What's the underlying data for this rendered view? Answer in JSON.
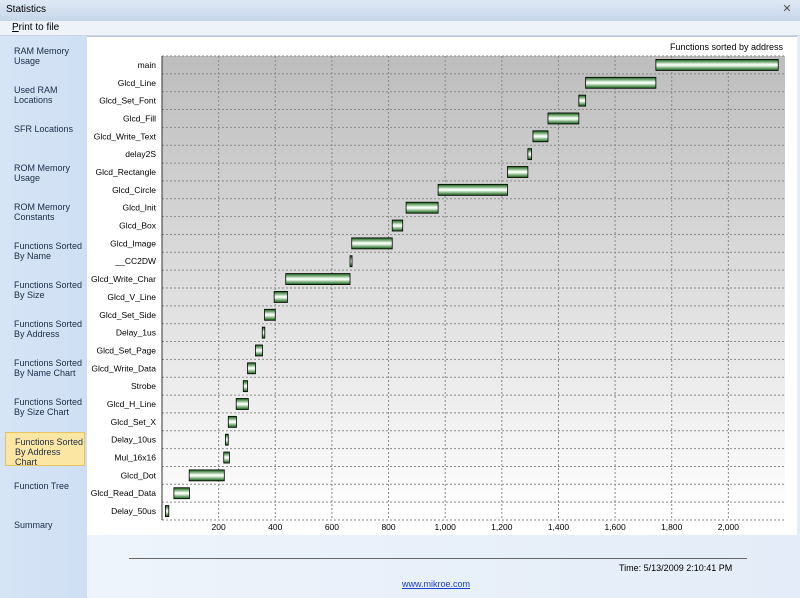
{
  "window": {
    "title": "Statistics",
    "close_glyph": "✕"
  },
  "menu": {
    "print_label_first": "P",
    "print_label_rest": "rint to file"
  },
  "sidebar": {
    "items": [
      {
        "line1": "RAM Memory",
        "line2": "Usage"
      },
      {
        "line1": "Used RAM",
        "line2": "Locations"
      },
      {
        "line1": "SFR Locations",
        "line2": ""
      },
      {
        "line1": "ROM Memory",
        "line2": "Usage"
      },
      {
        "line1": "ROM Memory",
        "line2": "Constants"
      },
      {
        "line1": "Functions Sorted",
        "line2": "By  Name"
      },
      {
        "line1": "Functions Sorted",
        "line2": "By Size"
      },
      {
        "line1": "Functions Sorted",
        "line2": "By Address"
      },
      {
        "line1": "Functions Sorted",
        "line2": "By Name Chart"
      },
      {
        "line1": "Functions Sorted",
        "line2": "By Size Chart"
      },
      {
        "line1": "Functions Sorted",
        "line2": "By Address Chart"
      },
      {
        "line1": "Function Tree",
        "line2": ""
      },
      {
        "line1": "Summary",
        "line2": ""
      }
    ],
    "active_index": 10
  },
  "chart_data": {
    "type": "bar",
    "orientation": "horizontal-range",
    "title": "Functions sorted by address",
    "xlabel": "",
    "ylabel": "",
    "xlim": [
      0,
      2200
    ],
    "xticks": [
      200,
      400,
      600,
      800,
      1000,
      1200,
      1400,
      1600,
      1800,
      2000
    ],
    "xtick_labels": [
      "200",
      "400",
      "600",
      "800",
      "1,000",
      "1,200",
      "1,400",
      "1,600",
      "1,800",
      "2,000"
    ],
    "grid": true,
    "categories": [
      "main",
      "Glcd_Line",
      "Glcd_Set_Font",
      "Glcd_Fill",
      "Glcd_Write_Text",
      "delay2S",
      "Glcd_Rectangle",
      "Glcd_Circle",
      "Glcd_Init",
      "Glcd_Box",
      "Glcd_Image",
      "__CC2DW",
      "Glcd_Write_Char",
      "Glcd_V_Line",
      "Glcd_Set_Side",
      "Delay_1us",
      "Glcd_Set_Page",
      "Glcd_Write_Data",
      "Strobe",
      "Glcd_H_Line",
      "Glcd_Set_X",
      "Delay_10us",
      "Mul_16x16",
      "Glcd_Dot",
      "Glcd_Read_Data",
      "Delay_50us"
    ],
    "start": [
      1744,
      1496,
      1472,
      1363,
      1310,
      1292,
      1220,
      975,
      862,
      813,
      670,
      664,
      437,
      396,
      362,
      354,
      330,
      302,
      287,
      262,
      234,
      224,
      218,
      96,
      42,
      12
    ],
    "end": [
      2176,
      1744,
      1496,
      1472,
      1363,
      1305,
      1292,
      1220,
      975,
      850,
      813,
      670,
      664,
      443,
      400,
      363,
      355,
      330,
      302,
      305,
      263,
      234,
      238,
      220,
      97,
      24
    ],
    "bar_color": "#2f9e2f"
  },
  "footer": {
    "timestamp": "Time: 5/13/2009 2:10:41 PM",
    "website": "www.mikroe.com"
  }
}
